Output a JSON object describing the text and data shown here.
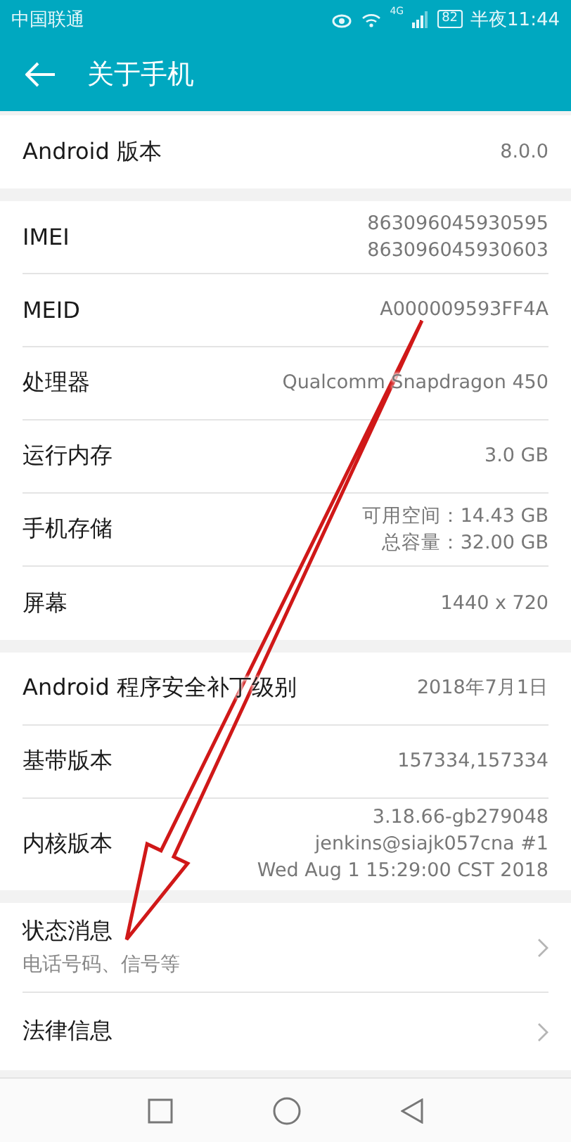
{
  "status_bar": {
    "carrier": "中国联通",
    "network": "4G",
    "battery": "82",
    "time": "半夜11:44"
  },
  "header": {
    "title": "关于手机"
  },
  "sections": [
    {
      "rows": [
        {
          "kind": "info",
          "label": "Android 版本",
          "values": [
            "8.0.0"
          ]
        }
      ]
    },
    {
      "rows": [
        {
          "kind": "info",
          "label": "IMEI",
          "values": [
            "863096045930595",
            "863096045930603"
          ]
        },
        {
          "kind": "info",
          "label": "MEID",
          "values": [
            "A000009593FF4A"
          ]
        },
        {
          "kind": "info",
          "label": "处理器",
          "values": [
            "Qualcomm Snapdragon 450"
          ]
        },
        {
          "kind": "info",
          "label": "运行内存",
          "values": [
            "3.0 GB"
          ]
        },
        {
          "kind": "info",
          "label": "手机存储",
          "values": [
            "可用空间：14.43  GB",
            "总容量：32.00  GB"
          ]
        },
        {
          "kind": "info",
          "label": "屏幕",
          "values": [
            "1440 x 720"
          ]
        }
      ]
    },
    {
      "rows": [
        {
          "kind": "info",
          "label": "Android 程序安全补丁级别",
          "values": [
            "2018年7月1日"
          ]
        },
        {
          "kind": "info",
          "label": "基带版本",
          "values": [
            "157334,157334"
          ]
        },
        {
          "kind": "info",
          "label": "内核版本",
          "values": [
            "3.18.66-gb279048",
            "jenkins@siajk057cna #1",
            "Wed Aug 1 15:29:00 CST 2018"
          ]
        }
      ]
    },
    {
      "rows": [
        {
          "kind": "link",
          "label": "状态消息",
          "sublabel": "电话号码、信号等"
        },
        {
          "kind": "link",
          "label": "法律信息"
        }
      ]
    }
  ]
}
